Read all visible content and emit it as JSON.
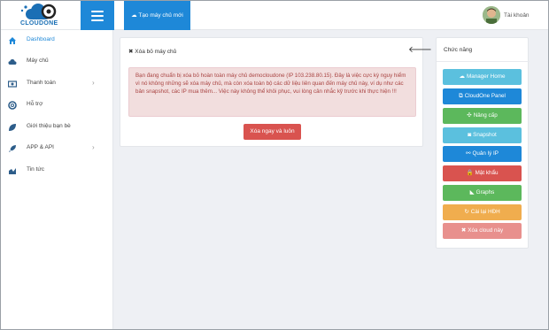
{
  "header": {
    "logo_text": "CLOUDONE",
    "new_server_label": "Tạo máy chủ mới",
    "account_label": "Tài khoản"
  },
  "sidebar": {
    "items": [
      {
        "label": "Dashboard",
        "icon": "home-icon",
        "active": true
      },
      {
        "label": "Máy chủ",
        "icon": "cloud-icon"
      },
      {
        "label": "Thanh toán",
        "icon": "payment-icon",
        "has_submenu": true
      },
      {
        "label": "Hỗ trợ",
        "icon": "support-icon"
      },
      {
        "label": "Giới thiệu bạn bè",
        "icon": "leaf-icon"
      },
      {
        "label": "APP & API",
        "icon": "rocket-icon",
        "has_submenu": true
      },
      {
        "label": "Tin tức",
        "icon": "chart-icon"
      }
    ]
  },
  "main": {
    "panel_title": "Xóa bỏ máy chủ",
    "alert_text": "Bạn đang chuẩn bị xóa bỏ hoàn toàn máy chủ democloudone (IP 103.238.80.15). Đây là việc cực kỳ nguy hiểm vì nó không những sẽ xóa máy chủ, mà còn xóa toàn bộ các dữ liệu liên quan đến máy chủ này, ví dụ như các bản snapshot, các IP mua thêm... Việc này không thể khôi phục, vui lòng cân nhắc kỹ trước khi thực hiện !!!",
    "delete_button": "Xóa ngay và luôn"
  },
  "functions": {
    "title": "Chức năng",
    "buttons": [
      {
        "label": "Manager Home",
        "icon": "cloud-icon",
        "color": "#5bc0de"
      },
      {
        "label": "CloudOne Panel",
        "icon": "external-link-icon",
        "color": "#1e88d8"
      },
      {
        "label": "Nâng cấp",
        "icon": "move-icon",
        "color": "#5cb85c"
      },
      {
        "label": "Snapshot",
        "icon": "camera-icon",
        "color": "#5bc0de"
      },
      {
        "label": "Quản lý IP",
        "icon": "sitemap-icon",
        "color": "#1e88d8"
      },
      {
        "label": "Mật khẩu",
        "icon": "lock-icon",
        "color": "#d9534f"
      },
      {
        "label": "Graphs",
        "icon": "area-chart-icon",
        "color": "#5cb85c"
      },
      {
        "label": "Cài lại HĐH",
        "icon": "refresh-icon",
        "color": "#f0ad4e"
      },
      {
        "label": "Xóa cloud này",
        "icon": "times-icon",
        "color": "#e8908d"
      }
    ]
  }
}
